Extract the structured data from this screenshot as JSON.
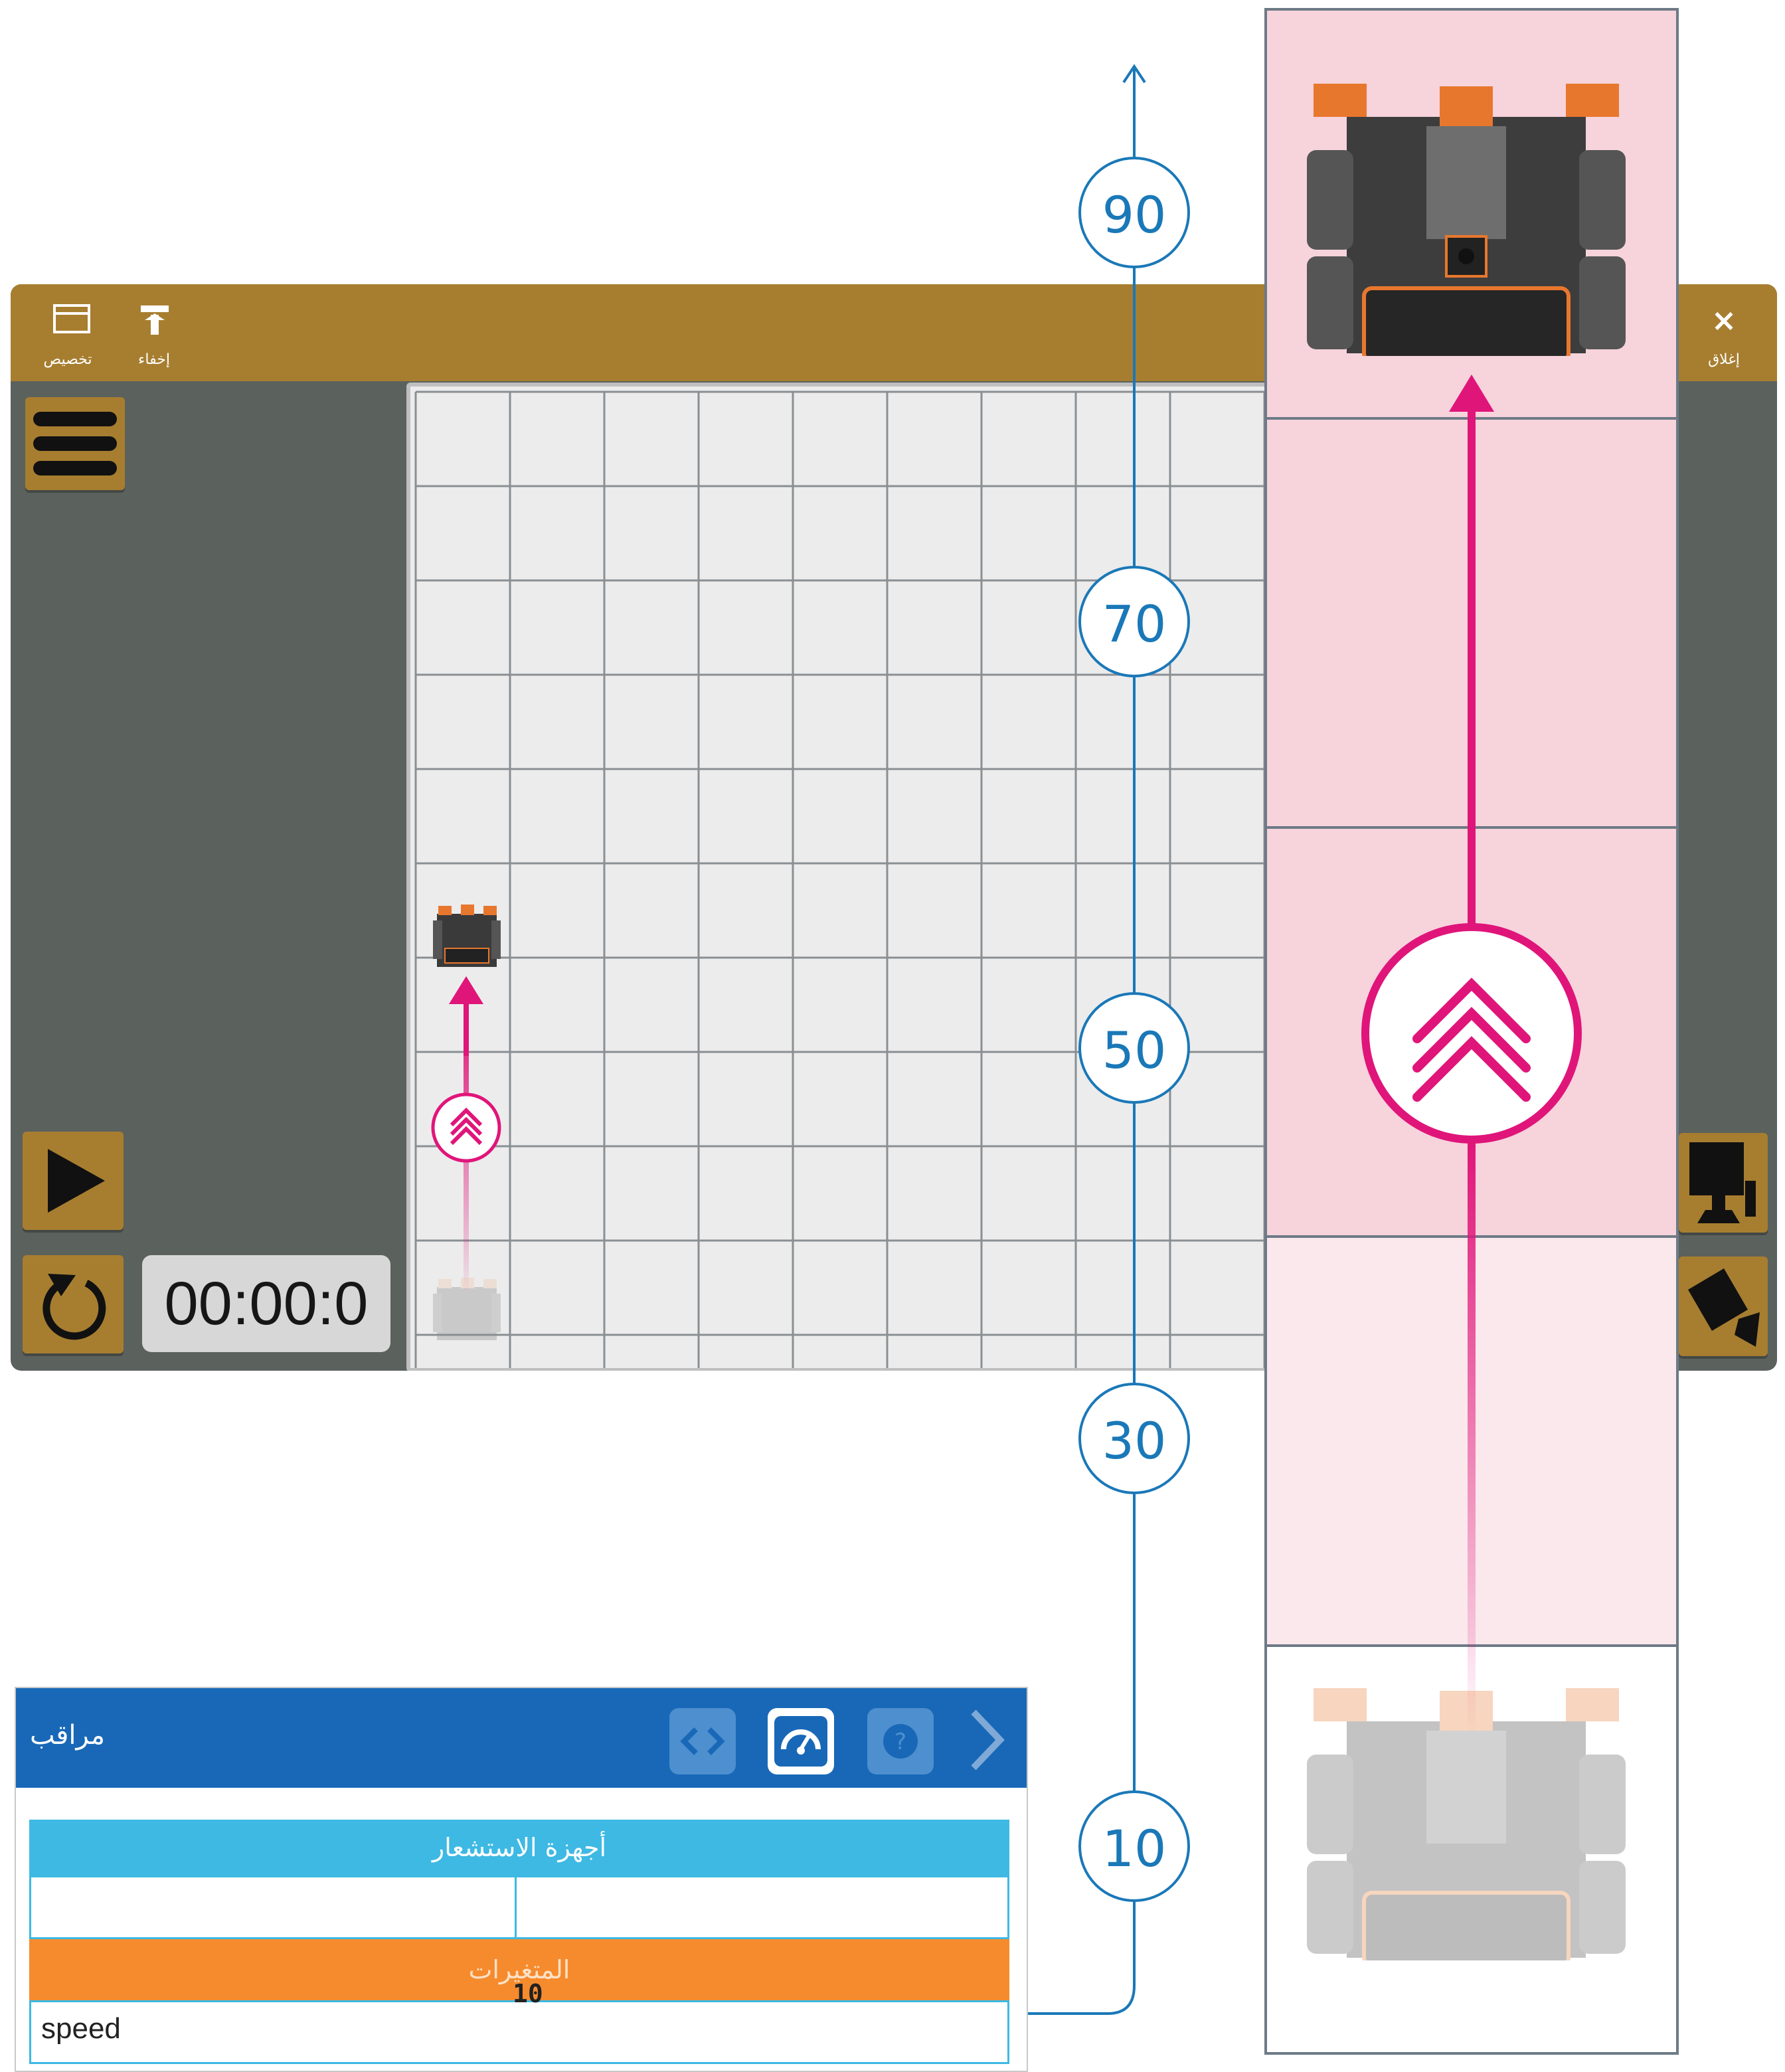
{
  "window": {
    "toolbar": {
      "customize_label": "تخصيص",
      "hide_label": "إخفاء",
      "close_label": "إغلاق",
      "close_icon": "×"
    },
    "timer": "00:00:0"
  },
  "measure_scale": {
    "values": [
      "90",
      "70",
      "50",
      "30",
      "10"
    ]
  },
  "monitor": {
    "title": "مراقب",
    "sensors_header": "أجهزة الاستشعار",
    "variables_header": "المتغيرات",
    "variables": [
      {
        "name": "speed",
        "value": "10"
      }
    ]
  },
  "colors": {
    "toolbar": "#a77e30",
    "workspace": "#5b615d",
    "path_magenta": "#e0157a",
    "zoom_pink": "#f7d3dc",
    "monitor_blue": "#1868b7",
    "sensors_cyan": "#3db9e4",
    "variables_orange": "#f68b2e",
    "marker_blue": "#1a78b8"
  }
}
